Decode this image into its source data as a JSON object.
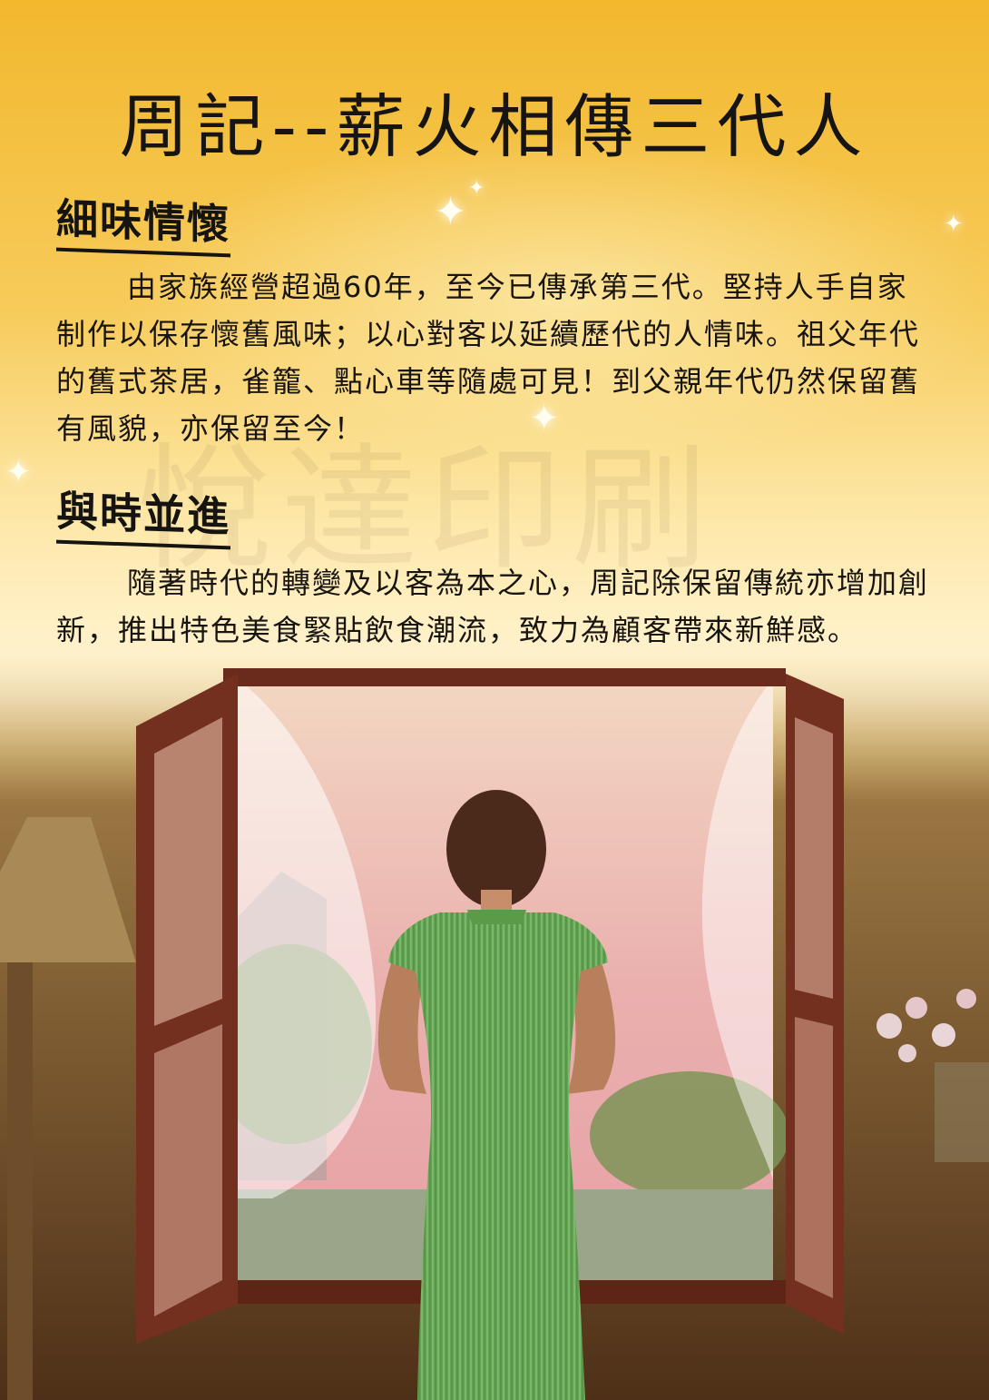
{
  "title": "周記--薪火相傳三代人",
  "sections": [
    {
      "heading": "細味情懷",
      "body": "由家族經營超過60年，至今已傳承第三代。堅持人手自家制作以保存懷舊風味；以心對客以延續歷代的人情味。祖父年代的舊式茶居，雀籠、點心車等隨處可見！到父親年代仍然保留舊有風貌，亦保留至今！"
    },
    {
      "heading": "與時並進",
      "body": "隨著時代的轉變及以客為本之心，周記除保留傳統亦增加創新，推出特色美食緊貼飲食潮流，致力為顧客帶來新鮮感。"
    }
  ],
  "watermark": "悅達印刷",
  "colors": {
    "background_top": "#f2b82e",
    "text": "#161513",
    "dress": "#6cae5a",
    "window_frame": "#6a2a1c",
    "sky": "#e9a6a6"
  }
}
